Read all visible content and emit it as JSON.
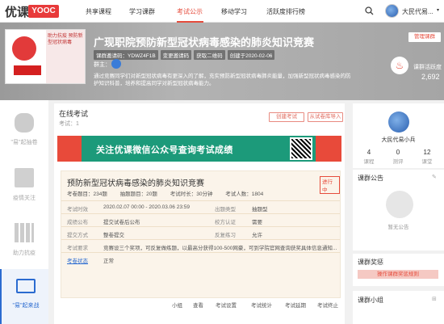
{
  "nav": {
    "logo_text": "优课",
    "logo_badge": "YOOC",
    "items": [
      "共享课程",
      "学习课群",
      "考试公示",
      "移动学习",
      "活跃度排行榜"
    ],
    "user": "大民代易..."
  },
  "header": {
    "title": "广现职院预防新型冠状病毒感染的肺炎知识竞赛",
    "invite_code": "课群邀请码：YDWZ4F1B",
    "change_code": "变更邀请码",
    "get_qr": "获取二维码",
    "created": "创建于2020-02-06",
    "owner_label": "群主：",
    "intro": "通过竞赛同学们对新型冠状病毒有更深入的了解，充实预防新型冠状病毒肺炎能量，加强新型冠状病毒感染的防护知识科普，培养和提高同学对新型冠状病毒能力。",
    "manage_btn": "管理课群",
    "activity_label": "课群活跃度",
    "activity_value": "2,692",
    "poster_text": "助力抗疫 预防新型冠状病毒"
  },
  "sidebar": [
    {
      "label": "\"易\"起抽卷"
    },
    {
      "label": "疫情关注"
    },
    {
      "label": "助力抗疫"
    },
    {
      "label": "\"易\"起来战"
    }
  ],
  "main": {
    "title": "在线考试",
    "subtitle": "考试：1",
    "btn_create": "创建考试",
    "btn_import": "从试卷库导入",
    "banner_text": "关注优课微信公众号查询考试成绩"
  },
  "exam": {
    "title": "预防新型冠状病毒感染的肺炎知识竞赛",
    "status": "进行中",
    "meta": [
      {
        "label": "考卷题目：",
        "value": "234题"
      },
      {
        "label": "抽题题目：",
        "value": "20题"
      },
      {
        "label": "考试时长：",
        "value": "30分钟"
      },
      {
        "label": "考试人数：",
        "value": "1804"
      }
    ],
    "rows": [
      {
        "l1": "考试时效",
        "v1": "2020.02.07 00:00 - 2020.03.06 23:59",
        "l2": "出题类型",
        "v2": "抽题型"
      },
      {
        "l1": "成绩公布",
        "v1": "提交试卷后公布",
        "l2": "校方认证",
        "v2": "需要"
      },
      {
        "l1": "提交方式",
        "v1": "整卷提交",
        "l2": "反复练习",
        "v2": "允许"
      },
      {
        "l1": "考试要求",
        "v1": "竞赛设三个奖项，可反复做练题，以最高分获得100-500网豪，可到学院官网查询获奖具体信息通知...",
        "l2": "",
        "v2": ""
      },
      {
        "l1": "考卷状态",
        "v1": "正常",
        "l2": "",
        "v2": ""
      }
    ],
    "actions": [
      "小组",
      "查看",
      "考试设置",
      "考试统计",
      "考试延期",
      "考试终止"
    ]
  },
  "profile": {
    "name": "大民代易小兵",
    "stats": [
      {
        "num": "4",
        "label": "课程"
      },
      {
        "num": "0",
        "label": "测评"
      },
      {
        "num": "12",
        "label": "课堂"
      }
    ]
  },
  "right": {
    "notice": "课群公告",
    "empty": "暂无公告",
    "reward": "课群奖惩",
    "reward_btn": "操作课群奖惩规则",
    "group": "课群小组"
  }
}
